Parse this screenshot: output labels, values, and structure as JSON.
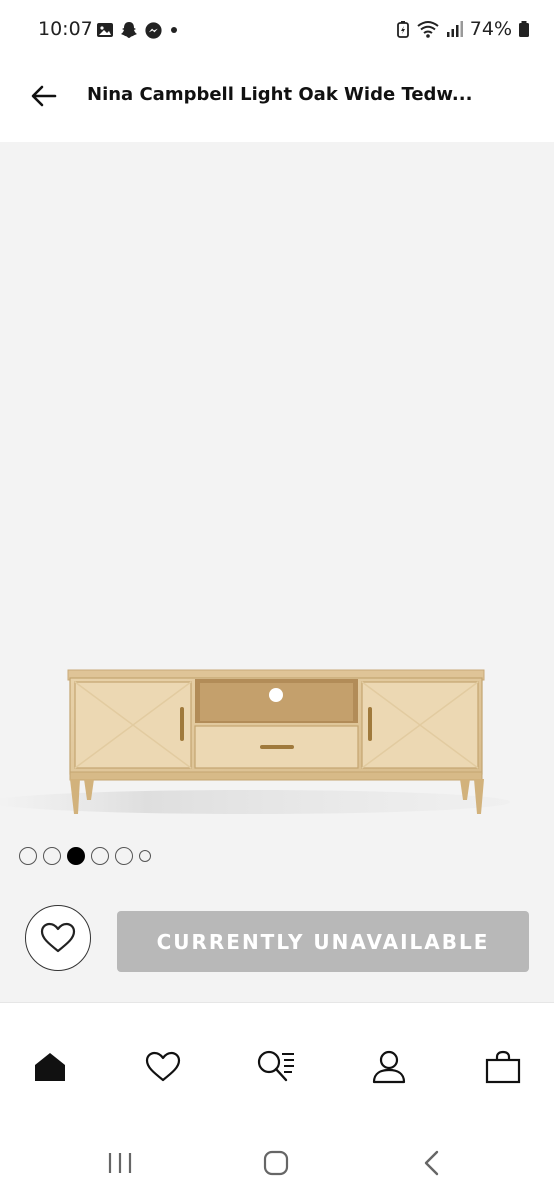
{
  "status_bar": {
    "time": "10:07",
    "left_icons": [
      "image-icon",
      "snapchat-icon",
      "messenger-icon",
      "dot-icon"
    ],
    "right_icons": [
      "battery-saver-icon",
      "wifi-icon",
      "signal-icon",
      "battery-icon"
    ],
    "battery_percent": "74%"
  },
  "header": {
    "title": "Nina Campbell Light Oak Wide Tedw..."
  },
  "carousel": {
    "total": 6,
    "active_index": 2
  },
  "actions": {
    "unavailable_label": "CURRENTLY UNAVAILABLE"
  },
  "bottom_nav": {
    "items": [
      "home-icon",
      "heart-icon",
      "search-list-icon",
      "account-icon",
      "bag-icon"
    ],
    "active": "home-icon"
  },
  "system_nav": {
    "items": [
      "recent-apps-icon",
      "home-button-icon",
      "back-button-icon"
    ]
  },
  "colors": {
    "image_bg": "#f3f3f3",
    "button_disabled": "#b8b8b8",
    "text": "#111111"
  }
}
